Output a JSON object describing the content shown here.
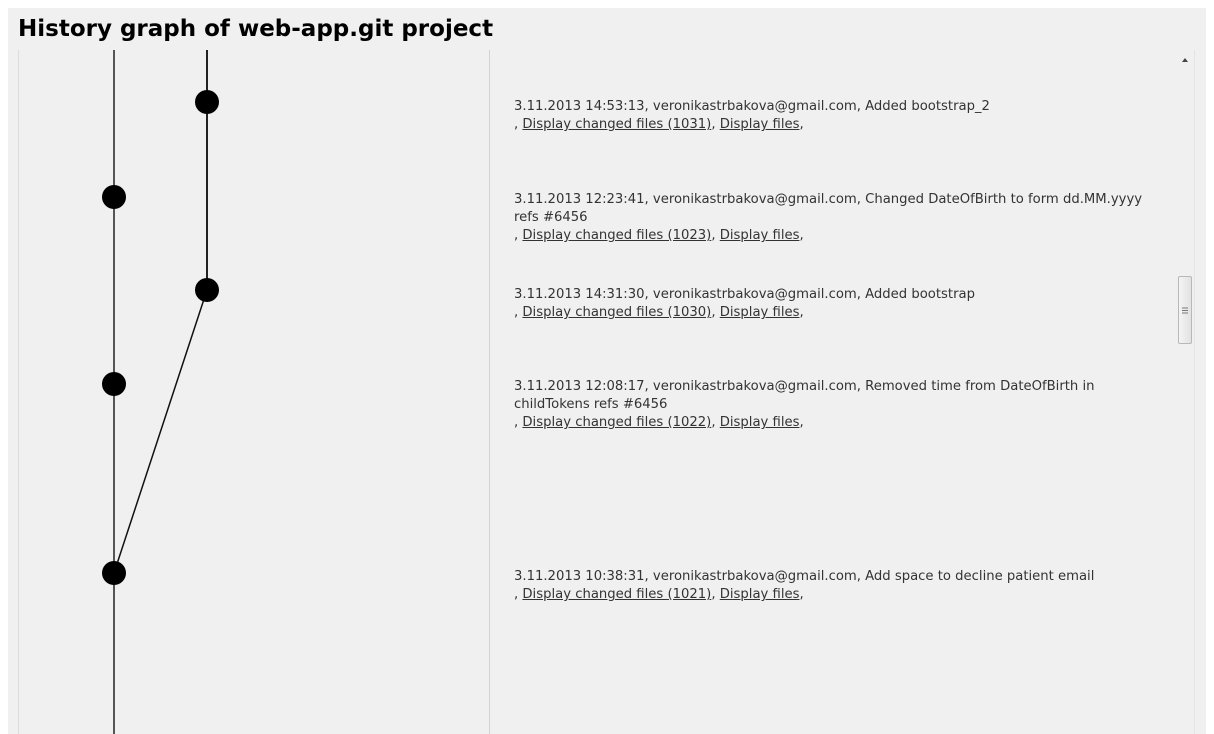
{
  "page": {
    "title": "History graph of web-app.git project"
  },
  "commits": [
    {
      "info": "3.11.2013 14:53:13, veronikastrbakova@gmail.com, Added bootstrap_2",
      "changed_files_label": "Display changed files (1031)",
      "files_label": "Display files",
      "lane": 1
    },
    {
      "info": "3.11.2013 12:23:41, veronikastrbakova@gmail.com, Changed DateOfBirth to form dd.MM.yyyy refs #6456",
      "changed_files_label": "Display changed files (1023)",
      "files_label": "Display files",
      "lane": 0
    },
    {
      "info": "3.11.2013 14:31:30, veronikastrbakova@gmail.com, Added bootstrap",
      "changed_files_label": "Display changed files (1030)",
      "files_label": "Display files",
      "lane": 1
    },
    {
      "info": "3.11.2013 12:08:17, veronikastrbakova@gmail.com, Removed time from DateOfBirth in childTokens refs #6456",
      "changed_files_label": "Display changed files (1022)",
      "files_label": "Display files",
      "lane": 0
    },
    {
      "info": "3.11.2013 10:38:31, veronikastrbakova@gmail.com, Add space to decline patient email",
      "changed_files_label": "Display changed files (1021)",
      "files_label": "Display files",
      "lane": 0
    }
  ],
  "separator": ",",
  "icons": {
    "scroll_up": "chevron-up-icon",
    "scroll_thumb_grip": "grip-icon"
  }
}
